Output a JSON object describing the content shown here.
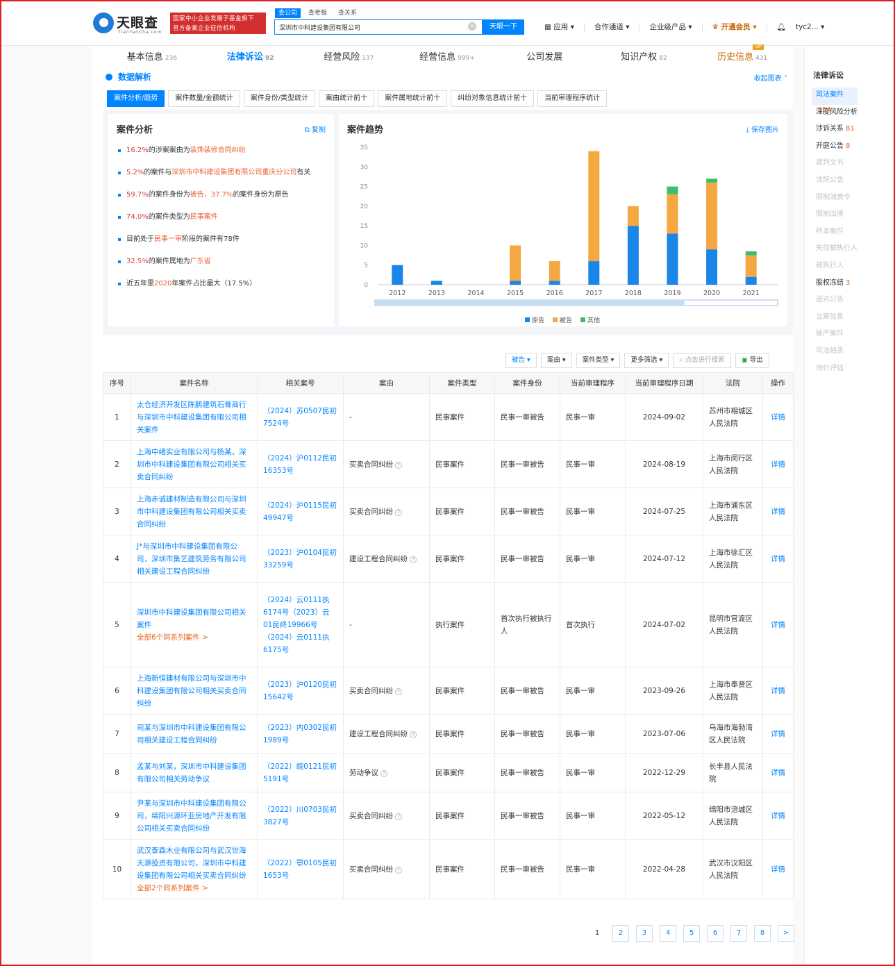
{
  "header": {
    "logo_name": "天眼查",
    "logo_sub": "TianYanCha.com",
    "badge_line1": "国家中小企业发展子基金旗下",
    "badge_line2": "官方备案企业征信机构",
    "search_tabs": [
      "查公司",
      "查老板",
      "查关系"
    ],
    "search_value": "深圳市中科建设集团有限公司",
    "search_button": "天眼一下",
    "menu": [
      "应用",
      "合作通道",
      "企业级产品",
      "开通会员",
      "tyc2..."
    ]
  },
  "tabs": [
    {
      "label": "基本信息",
      "count": "236"
    },
    {
      "label": "法律诉讼",
      "count": "92"
    },
    {
      "label": "经营风险",
      "count": "137"
    },
    {
      "label": "经营信息",
      "count": "999+"
    },
    {
      "label": "公司发展",
      "count": ""
    },
    {
      "label": "知识产权",
      "count": "82"
    },
    {
      "label": "历史信息",
      "count": "431"
    }
  ],
  "vip_flag": "VIP",
  "data_section": {
    "title": "数据解析",
    "collapse": "收起图表",
    "filter_tabs": [
      "案件分析/趋势",
      "案件数量/金额统计",
      "案件身份/类型统计",
      "案由统计前十",
      "案件属地统计前十",
      "纠纷对象信息统计前十",
      "当前审理程序统计"
    ]
  },
  "analysis": {
    "title": "案件分析",
    "copy": "复制",
    "items": [
      {
        "a": "16.2%",
        "b": "的涉案案由为",
        "c": "装饰装修合同纠纷",
        "d": ""
      },
      {
        "a": "5.2%",
        "b": "的案件与",
        "c": "深圳市中科建设集团有限公司重庆分公司",
        "d": "有关"
      },
      {
        "a": "59.7%",
        "b": "的案件身份为",
        "c": "被告，37.7%",
        "d": "的案件身份为原告"
      },
      {
        "a": "74.0%",
        "b": "的案件类型为",
        "c": "民事案件",
        "d": ""
      },
      {
        "a": "",
        "b": "目前处于",
        "c": "民事一审",
        "d": "阶段的案件有78件"
      },
      {
        "a": "32.5%",
        "b": "的案件属地为",
        "c": "广东省",
        "d": ""
      },
      {
        "a": "",
        "b": "近五年里",
        "c": "2020",
        "d": "年案件占比最大（17.5%）"
      }
    ]
  },
  "trend": {
    "title": "案件趋势",
    "save": "保存图片"
  },
  "chart_data": {
    "type": "bar",
    "stacked": true,
    "title": "案件趋势",
    "categories": [
      "2012",
      "2013",
      "2014",
      "2015",
      "2016",
      "2017",
      "2018",
      "2019",
      "2020",
      "2021"
    ],
    "series": [
      {
        "name": "原告",
        "color": "#1a86e8",
        "values": [
          5,
          1,
          0,
          1,
          1,
          6,
          15,
          13,
          9,
          2
        ]
      },
      {
        "name": "被告",
        "color": "#f5a742",
        "values": [
          0,
          0,
          0,
          9,
          5,
          28,
          5,
          10,
          17,
          5.5
        ]
      },
      {
        "name": "其他",
        "color": "#3cbf6c",
        "values": [
          0,
          0,
          0,
          0,
          0,
          0,
          0,
          2,
          1,
          1
        ]
      }
    ],
    "ylim": [
      0,
      35
    ],
    "yticks": [
      0,
      5,
      10,
      15,
      20,
      25,
      30,
      35
    ],
    "legend": "bottom-center",
    "grid": false
  },
  "toolbar": [
    "被告",
    "案由",
    "案件类型",
    "更多筛选",
    "点击进行搜索",
    "导出"
  ],
  "table": {
    "headers": [
      "序号",
      "案件名称",
      "相关案号",
      "案由",
      "案件类型",
      "案件身份",
      "当前审理程序",
      "当前审理程序日期",
      "法院",
      "操作"
    ],
    "rows": [
      {
        "no": "1",
        "name": "太仓经济开发区陈鹏建筑石膏商行与深圳市中科建设集团有限公司相关案件",
        "extra": "",
        "case_no": "（2024）苏0507民初7524号",
        "cause": "-",
        "type": "民事案件",
        "role": "民事一审被告",
        "proc": "民事一审",
        "date": "2024-09-02",
        "court": "苏州市相城区人民法院",
        "op": "详情"
      },
      {
        "no": "2",
        "name": "上海中绪实业有限公司与杨某，深圳市中科建设集团有限公司相关买卖合同纠纷",
        "extra": "",
        "case_no": "（2024）沪0112民初16353号",
        "cause": "买卖合同纠纷",
        "type": "民事案件",
        "role": "民事一审被告",
        "proc": "民事一审",
        "date": "2024-08-19",
        "court": "上海市闵行区人民法院",
        "op": "详情"
      },
      {
        "no": "3",
        "name": "上海赤诚建材制造有限公司与深圳市中科建设集团有限公司相关买卖合同纠纷",
        "extra": "",
        "case_no": "（2024）沪0115民初49947号",
        "cause": "买卖合同纠纷",
        "type": "民事案件",
        "role": "民事一审被告",
        "proc": "民事一审",
        "date": "2024-07-25",
        "court": "上海市浦东区人民法院",
        "op": "详情"
      },
      {
        "no": "4",
        "name": "J*与深圳市中科建设集团有限公司，深圳市集艺建筑劳务有限公司相关建设工程合同纠纷",
        "extra": "",
        "case_no": "（2023）沪0104民初33259号",
        "cause": "建设工程合同纠纷",
        "type": "民事案件",
        "role": "民事一审被告",
        "proc": "民事一审",
        "date": "2024-07-12",
        "court": "上海市徐汇区人民法院",
        "op": "详情"
      },
      {
        "no": "5",
        "name": "深圳市中科建设集团有限公司相关案件",
        "extra": "全部6个同系列案件 >",
        "case_no": "（2024）云0111执6174号（2023）云01民终19966号（2024）云0111执6175号",
        "cause": "-",
        "type": "执行案件",
        "role": "首次执行被执行人",
        "proc": "首次执行",
        "date": "2024-07-02",
        "court": "昆明市官渡区人民法院",
        "op": "详情"
      },
      {
        "no": "6",
        "name": "上海新恒建材有限公司与深圳市中科建设集团有限公司相关买卖合同纠纷",
        "extra": "",
        "case_no": "（2023）沪0120民初15642号",
        "cause": "买卖合同纠纷",
        "type": "民事案件",
        "role": "民事一审被告",
        "proc": "民事一审",
        "date": "2023-09-26",
        "court": "上海市奉贤区人民法院",
        "op": "详情"
      },
      {
        "no": "7",
        "name": "司某与深圳市中科建设集团有限公司相关建设工程合同纠纷",
        "extra": "",
        "case_no": "（2023）内0302民初1989号",
        "cause": "建设工程合同纠纷",
        "type": "民事案件",
        "role": "民事一审被告",
        "proc": "民事一审",
        "date": "2023-07-06",
        "court": "乌海市海勃湾区人民法院",
        "op": "详情"
      },
      {
        "no": "8",
        "name": "孟某与刘某，深圳市中科建设集团有限公司相关劳动争议",
        "extra": "",
        "case_no": "（2022）皖0121民初5191号",
        "cause": "劳动争议",
        "type": "民事案件",
        "role": "民事一审被告",
        "proc": "民事一审",
        "date": "2022-12-29",
        "court": "长丰县人民法院",
        "op": "详情"
      },
      {
        "no": "9",
        "name": "尹某与深圳市中科建设集团有限公司，绵阳兴源环亚房地产开发有限公司相关买卖合同纠纷",
        "extra": "",
        "case_no": "（2022）川0703民初3827号",
        "cause": "买卖合同纠纷",
        "type": "民事案件",
        "role": "民事一审被告",
        "proc": "民事一审",
        "date": "2022-05-12",
        "court": "绵阳市涪城区人民法院",
        "op": "详情"
      },
      {
        "no": "10",
        "name": "武汉泰森木业有限公司与武汉世海天源投资有限公司，深圳市中科建设集团有限公司相关买卖合同纠纷",
        "extra": "全部2个同系列案件 >",
        "case_no": "（2022）鄂0105民初1653号",
        "cause": "买卖合同纠纷",
        "type": "民事案件",
        "role": "民事一审被告",
        "proc": "民事一审",
        "date": "2022-04-28",
        "court": "武汉市汉阳区人民法院",
        "op": "详情"
      }
    ]
  },
  "pager": [
    "1",
    "2",
    "3",
    "4",
    "5",
    "6",
    "7",
    "8",
    ">"
  ],
  "sidebar": {
    "title": "法律诉讼",
    "items": [
      {
        "label": "司法案件",
        "count": "154",
        "state": "on"
      },
      {
        "label": "深度风险分析",
        "count": "",
        "state": ""
      },
      {
        "label": "涉诉关系",
        "count": "81",
        "state": ""
      },
      {
        "label": "开庭公告",
        "count": "8",
        "state": ""
      },
      {
        "label": "裁判文书",
        "count": "",
        "state": "dim"
      },
      {
        "label": "法院公告",
        "count": "",
        "state": "dim"
      },
      {
        "label": "限制消费令",
        "count": "",
        "state": "dim"
      },
      {
        "label": "限制出境",
        "count": "",
        "state": "dim"
      },
      {
        "label": "终本案件",
        "count": "",
        "state": "dim"
      },
      {
        "label": "失信被执行人",
        "count": "",
        "state": "dim"
      },
      {
        "label": "被执行人",
        "count": "",
        "state": "dim"
      },
      {
        "label": "股权冻结",
        "count": "3",
        "state": ""
      },
      {
        "label": "送达公告",
        "count": "",
        "state": "dim"
      },
      {
        "label": "立案信息",
        "count": "",
        "state": "dim"
      },
      {
        "label": "破产案件",
        "count": "",
        "state": "dim"
      },
      {
        "label": "司法拍卖",
        "count": "",
        "state": "dim"
      },
      {
        "label": "询价评估",
        "count": "",
        "state": "dim"
      }
    ]
  }
}
